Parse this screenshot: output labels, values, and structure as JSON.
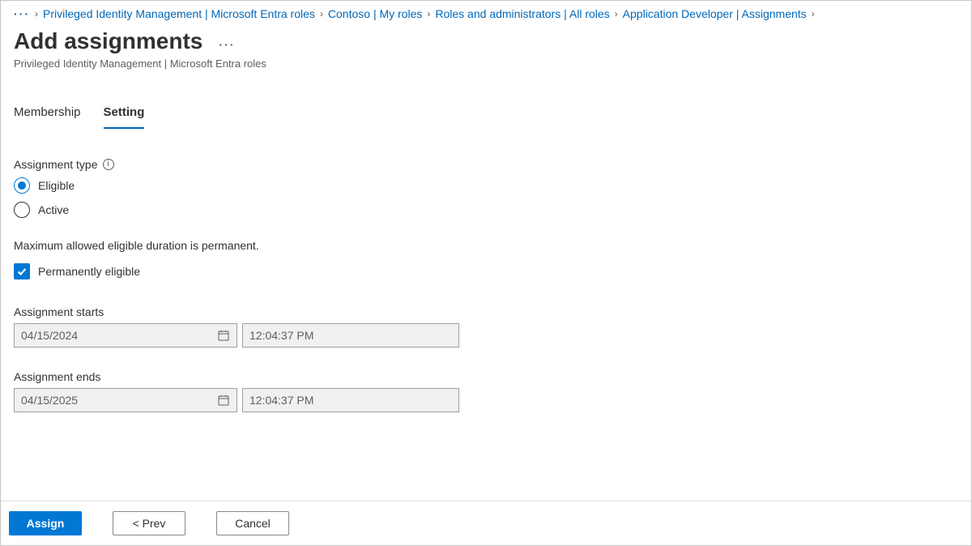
{
  "breadcrumb": {
    "items": [
      "Privileged Identity Management | Microsoft Entra roles",
      "Contoso | My roles",
      "Roles and administrators | All roles",
      "Application Developer | Assignments"
    ]
  },
  "header": {
    "title": "Add assignments",
    "subtitle": "Privileged Identity Management | Microsoft Entra roles"
  },
  "tabs": [
    "Membership",
    "Setting"
  ],
  "activeTab": "Setting",
  "form": {
    "assignment_type_label": "Assignment type",
    "assignment_types": [
      {
        "label": "Eligible",
        "selected": true
      },
      {
        "label": "Active",
        "selected": false
      }
    ],
    "duration_note": "Maximum allowed eligible duration is permanent.",
    "perm_eligible_label": "Permanently eligible",
    "perm_eligible_checked": true,
    "starts_label": "Assignment starts",
    "starts_date": "04/15/2024",
    "starts_time": "12:04:37 PM",
    "ends_label": "Assignment ends",
    "ends_date": "04/15/2025",
    "ends_time": "12:04:37 PM"
  },
  "footer": {
    "assign": "Assign",
    "prev": "< Prev",
    "cancel": "Cancel"
  }
}
